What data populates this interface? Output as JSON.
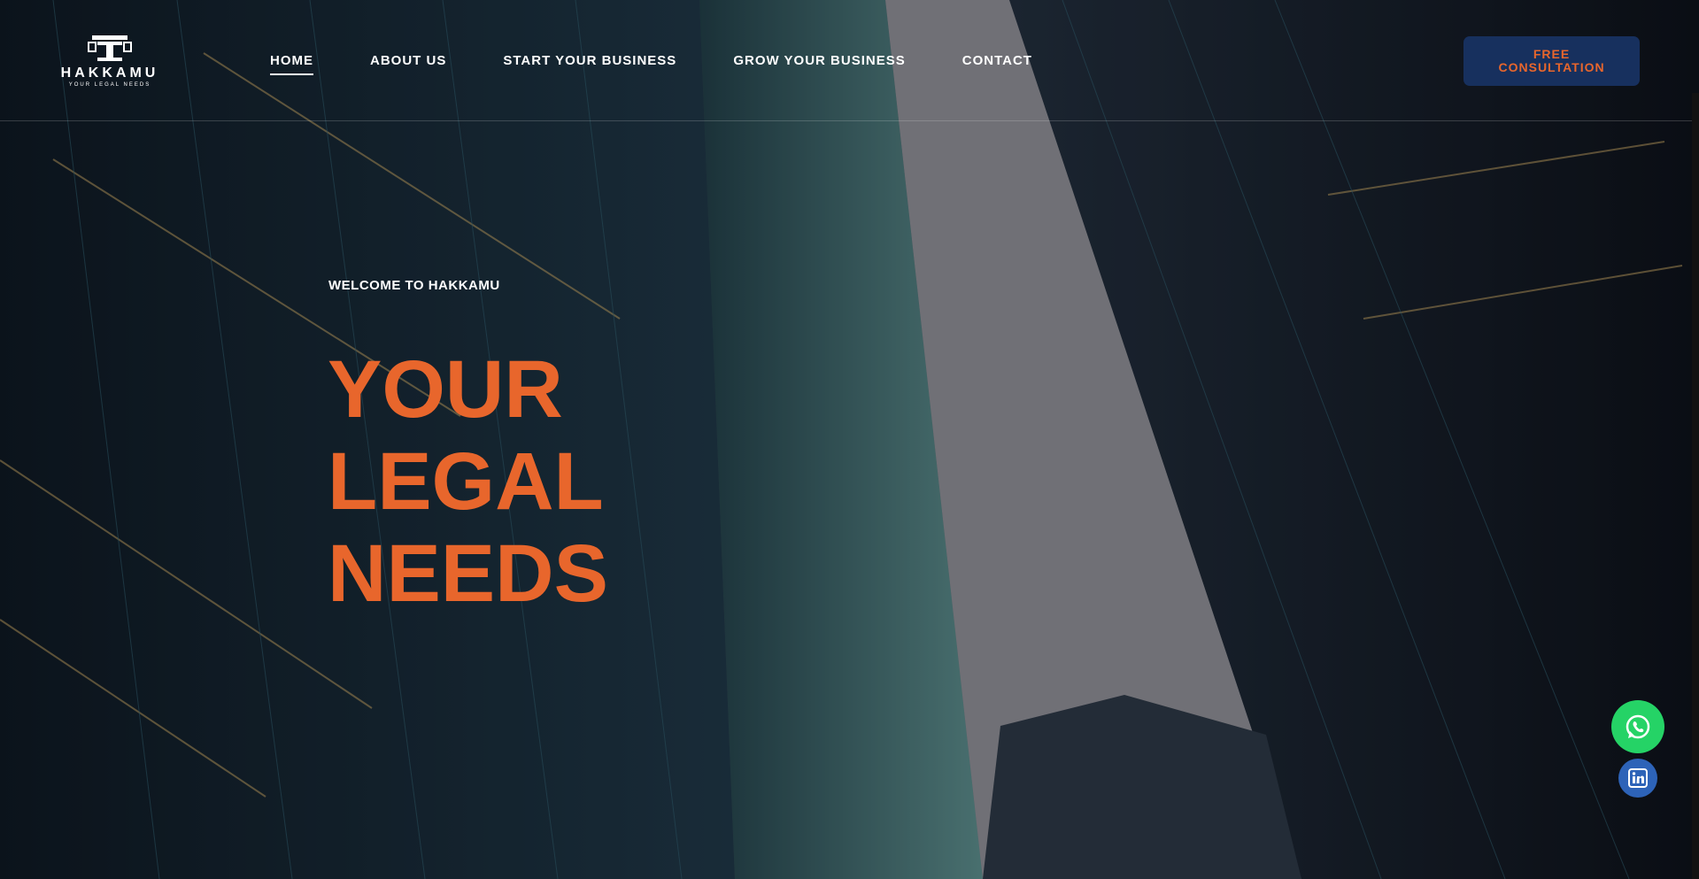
{
  "brand": {
    "name": "HAKKAMU",
    "tagline": "YOUR LEGAL NEEDS",
    "logo_icon": "scales-logo-icon"
  },
  "nav": {
    "items": [
      {
        "label": "HOME",
        "active": true
      },
      {
        "label": "ABOUT US",
        "active": false
      },
      {
        "label": "START YOUR BUSINESS",
        "active": false
      },
      {
        "label": "GROW YOUR BUSINESS",
        "active": false
      },
      {
        "label": "CONTACT",
        "active": false
      }
    ]
  },
  "cta": {
    "label": "FREE CONSULTATION"
  },
  "hero": {
    "kicker": "WELCOME TO HAKKAMU",
    "headline": [
      "YOUR",
      "LEGAL",
      "NEEDS"
    ]
  },
  "floating": {
    "whatsapp_icon": "whatsapp-icon",
    "linkedin_icon": "linkedin-icon"
  },
  "colors": {
    "accent": "#e8662c",
    "cta_bg": "#17305e",
    "whatsapp": "#25d366",
    "linkedin": "#2d63b8"
  }
}
